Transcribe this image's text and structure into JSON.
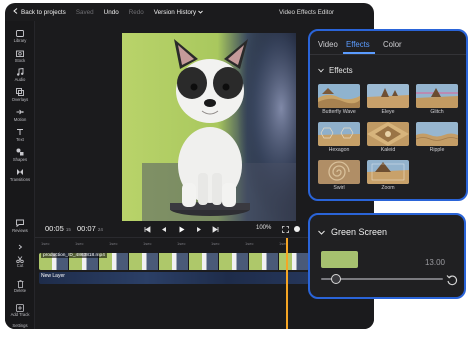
{
  "topbar": {
    "back_label": "Back to projects",
    "saved_label": "Saved",
    "undo_label": "Undo",
    "redo_label": "Redo",
    "history_label": "Version History",
    "title": "Video Effects Editor"
  },
  "sidebar": {
    "items": [
      {
        "label": "Library",
        "icon": "library-icon"
      },
      {
        "label": "Stock",
        "icon": "stock-icon"
      },
      {
        "label": "Audio",
        "icon": "music-icon"
      },
      {
        "label": "Overlays",
        "icon": "overlays-icon"
      },
      {
        "label": "Motion",
        "icon": "motion-icon"
      },
      {
        "label": "Text",
        "icon": "text-icon"
      },
      {
        "label": "Shapes",
        "icon": "shapes-icon"
      },
      {
        "label": "Transitions",
        "icon": "transitions-icon"
      },
      {
        "label": "Reviews",
        "icon": "reviews-icon"
      }
    ]
  },
  "player": {
    "current_time": "00:05",
    "current_frames": "15",
    "total_time": "00:07",
    "total_frames": "24",
    "zoom": "100%"
  },
  "timeline": {
    "tools": [
      {
        "label": "Cut",
        "icon": "scissors-icon"
      },
      {
        "label": "Delete",
        "icon": "trash-icon"
      },
      {
        "label": "Add Track",
        "icon": "add-track-icon"
      },
      {
        "label": "Settings",
        "icon": "settings-icon"
      }
    ],
    "ruler": [
      "1sec",
      "1sec",
      "1sec",
      "1sec",
      "1sec",
      "1sec",
      "1sec",
      "1sec"
    ],
    "main_clip": "production_ID_4863818.mp4",
    "layer_clip": "New Layer"
  },
  "panel": {
    "tabs": [
      "Video",
      "Effects",
      "Color"
    ],
    "active_tab": "Effects",
    "section_title": "Effects",
    "effects": [
      {
        "label": "Butterfly Wave"
      },
      {
        "label": "Eleye"
      },
      {
        "label": "Glitch"
      },
      {
        "label": "Hexagon"
      },
      {
        "label": "Kaleid"
      },
      {
        "label": "Ripple"
      },
      {
        "label": "Swirl"
      },
      {
        "label": "Zoom"
      }
    ]
  },
  "green_screen": {
    "title": "Green Screen",
    "color": "#a6c16f",
    "value": "13.00",
    "slider_fraction": 0.12
  },
  "colors": {
    "accent": "#2a64d8",
    "tab_active": "#5b9cff",
    "playhead": "#f5a524",
    "background": "#1b1b1d"
  }
}
